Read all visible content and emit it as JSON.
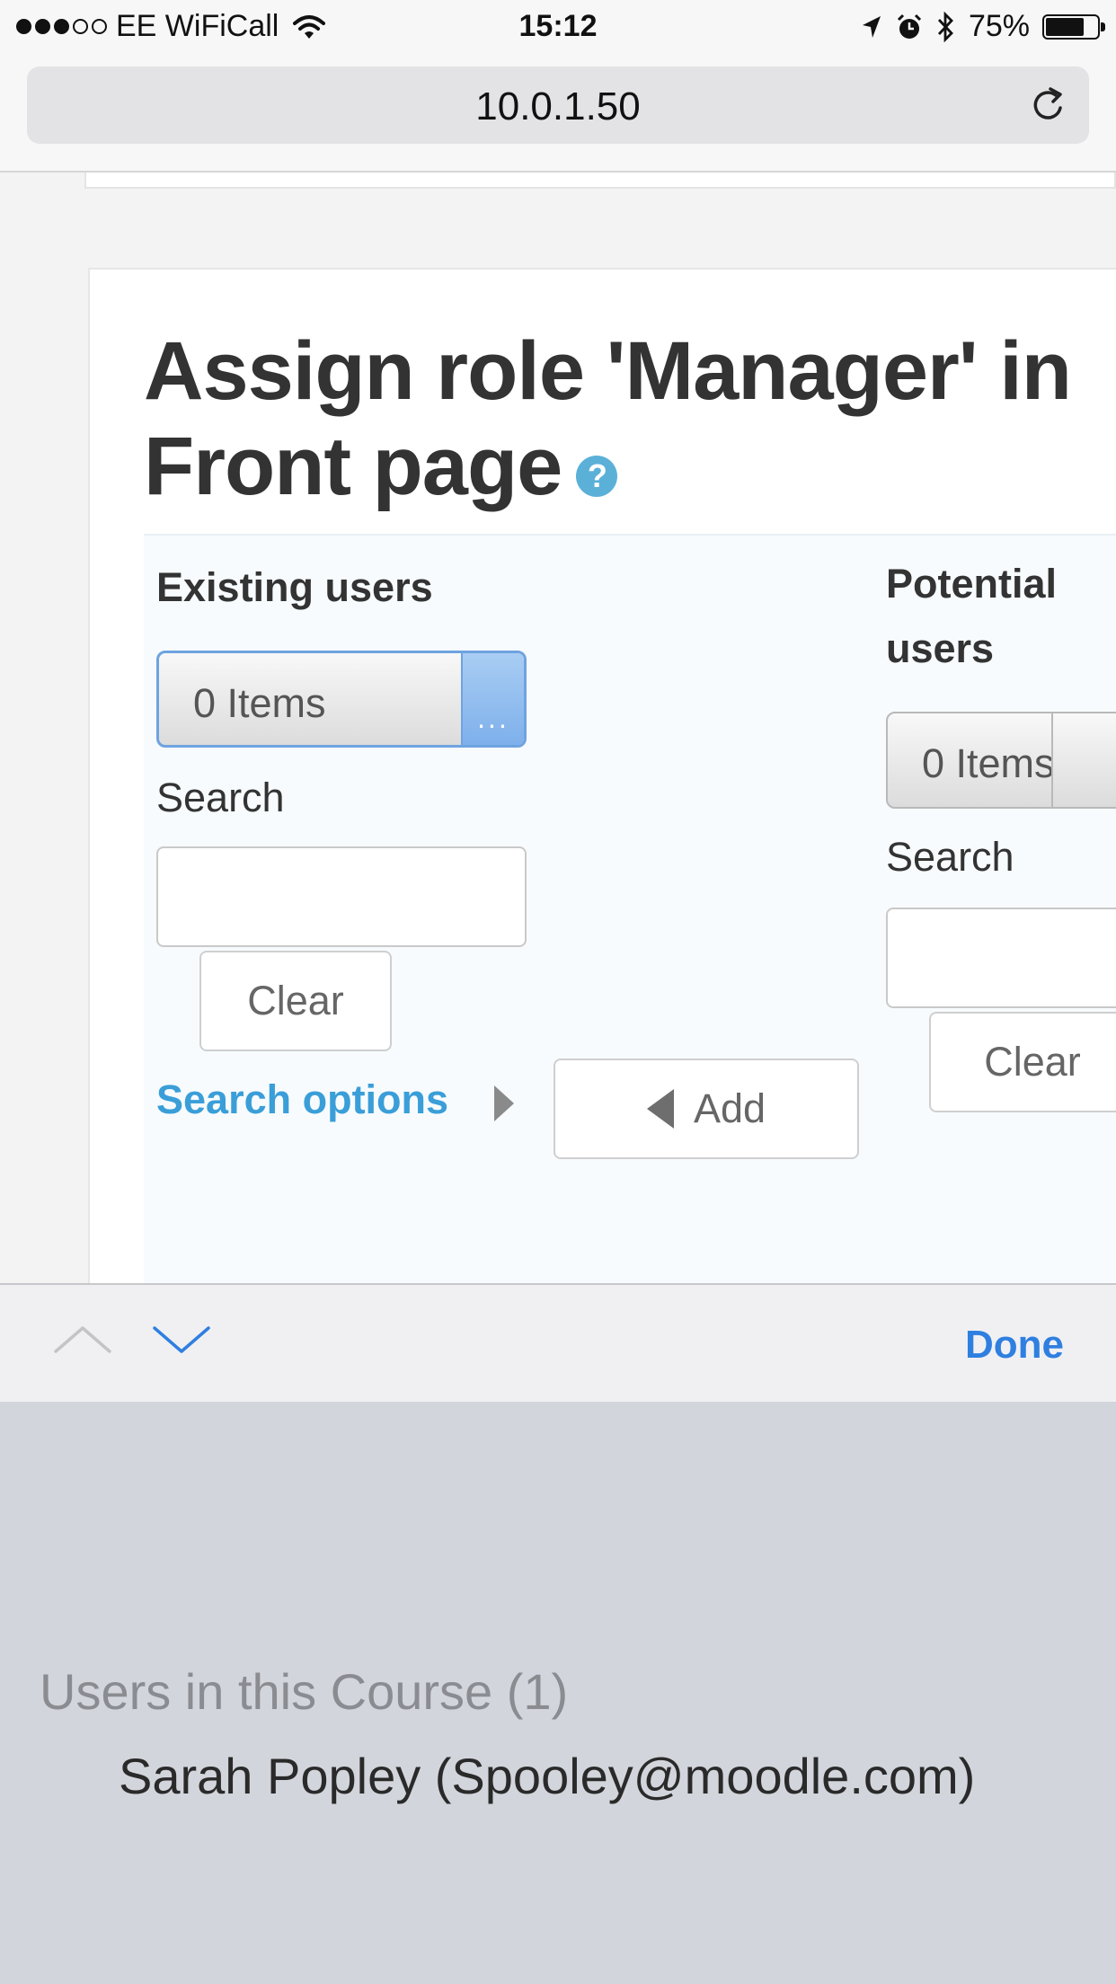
{
  "status_bar": {
    "carrier": "EE WiFiCall",
    "signal_dots": [
      true,
      true,
      true,
      false,
      false
    ],
    "time": "15:12",
    "battery_percent": "75%",
    "battery_level": 0.75
  },
  "browser": {
    "url": "10.0.1.50"
  },
  "page": {
    "title": "Assign role 'Manager' in Front page",
    "help_glyph": "?",
    "existing": {
      "heading": "Existing users",
      "select_value": "0 Items",
      "select_button": "...",
      "search_label": "Search",
      "search_value": "",
      "clear_label": "Clear"
    },
    "search_options_label": "Search options",
    "add_label": "Add",
    "potential": {
      "heading_line1": "Potential",
      "heading_line2": "users",
      "select_value": "0 Items",
      "search_label": "Search",
      "search_value": "",
      "clear_label": "Clear"
    }
  },
  "accessory": {
    "done_label": "Done"
  },
  "picker": {
    "group_label": "Users in this Course (1)",
    "options": [
      "Sarah Popley (Spooley@moodle.com)"
    ]
  },
  "colors": {
    "link": "#3a9ed8",
    "done": "#2f7fe0",
    "help": "#5bb0d8",
    "select_active": "#7eb0eb"
  }
}
